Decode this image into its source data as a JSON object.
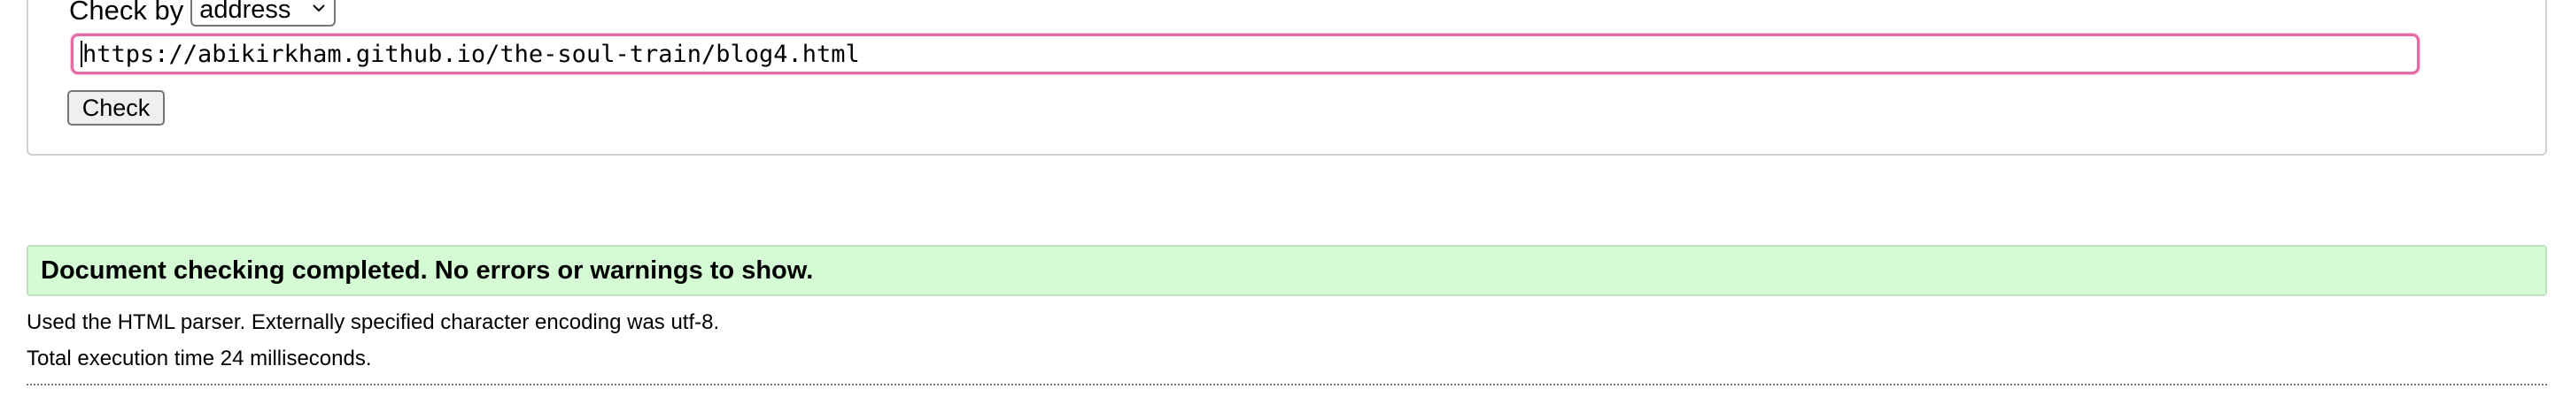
{
  "form": {
    "check_by_label": "Check by",
    "check_by_select": {
      "selected": "address"
    },
    "url_input": {
      "value": "https://abikirkham.github.io/the-soul-train/blog4.html"
    },
    "check_button_label": "Check"
  },
  "results": {
    "success_message": "Document checking completed. No errors or warnings to show.",
    "parser_info": "Used the HTML parser. Externally specified character encoding was utf-8.",
    "execution_time": "Total execution time 24 milliseconds."
  },
  "colors": {
    "success_background": "#d4fbd4",
    "input_focus_border": "#e36aa5"
  },
  "icons": {
    "select_arrow": "chevron-down-icon"
  }
}
